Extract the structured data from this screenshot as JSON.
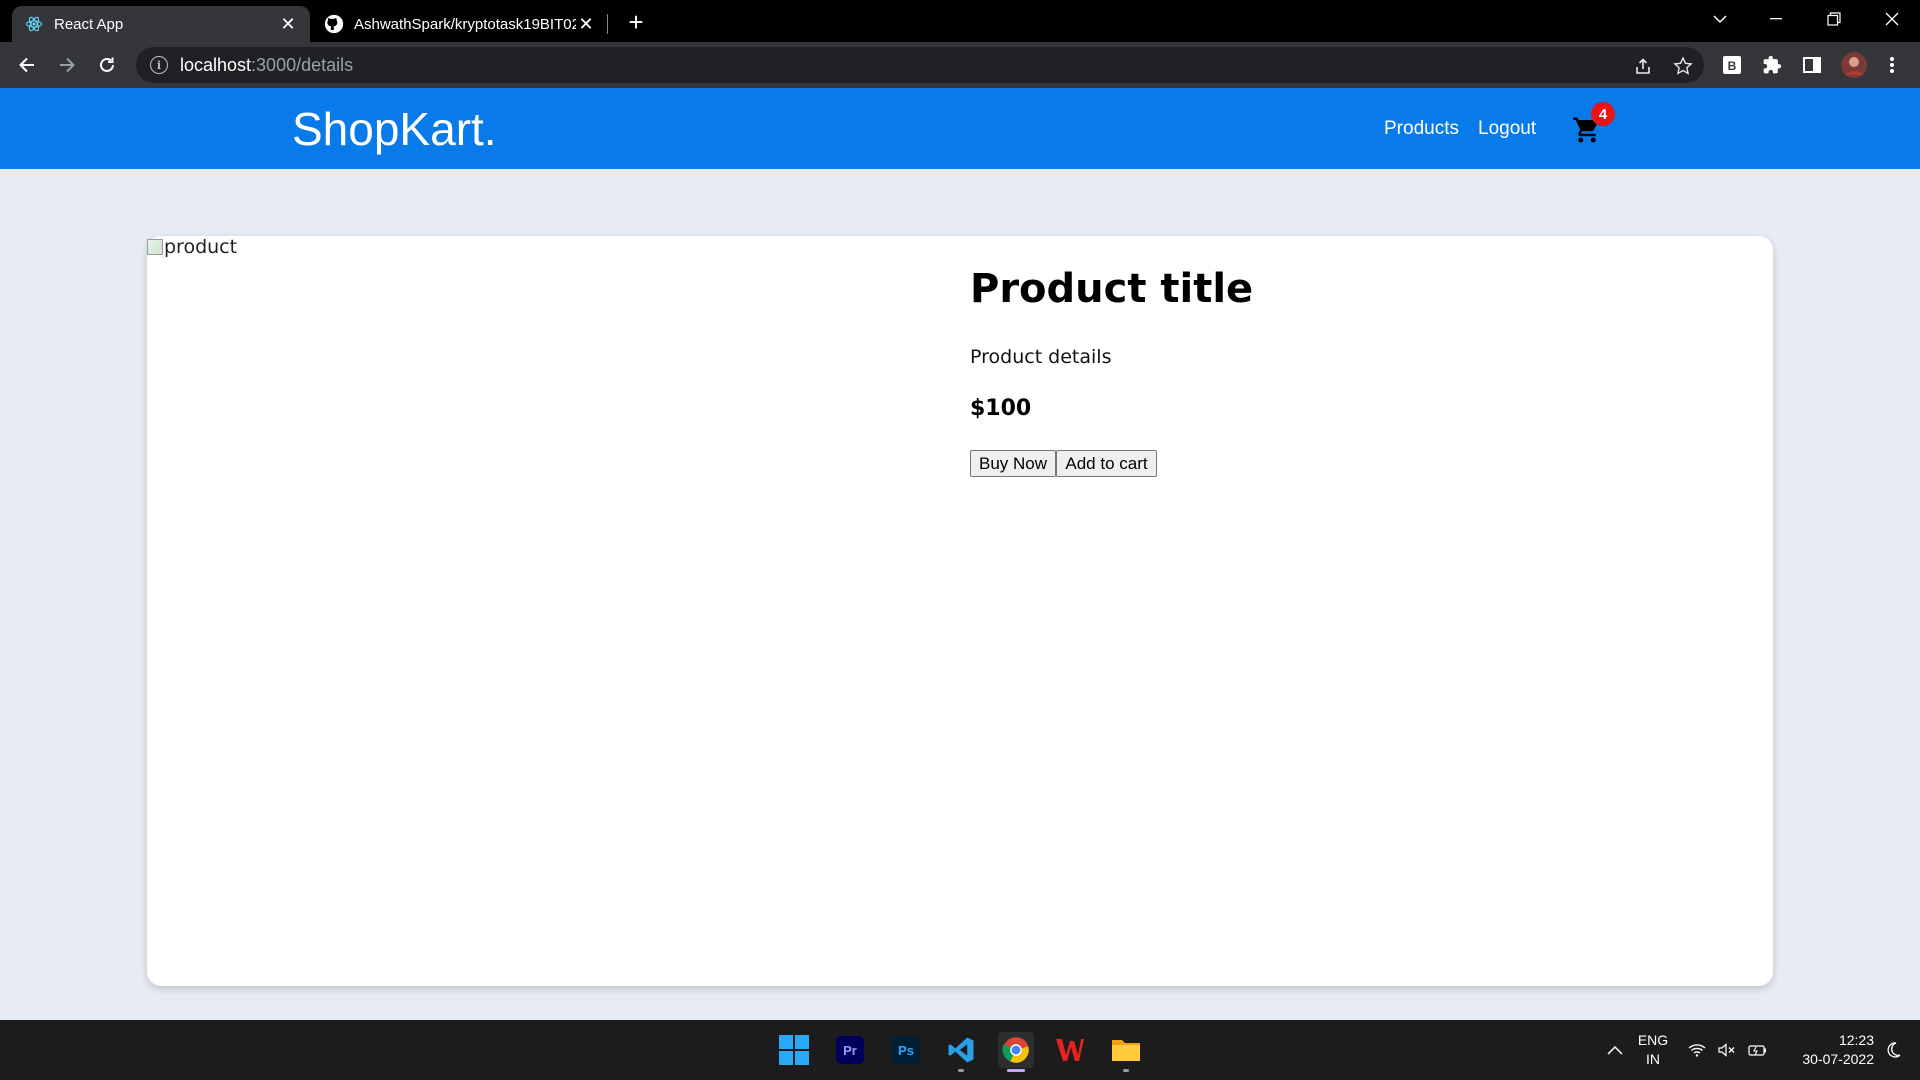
{
  "browser": {
    "tabs": [
      {
        "title": "React App",
        "icon": "react-icon",
        "active": true
      },
      {
        "title": "AshwathSpark/kryptotask19BIT02",
        "icon": "github-icon",
        "active": false
      }
    ],
    "url_host": "localhost",
    "url_path": ":3000/details"
  },
  "app": {
    "brand": "ShopKart.",
    "nav": {
      "products": "Products",
      "logout": "Logout"
    },
    "cart_count": "4",
    "header_color": "#087ae9"
  },
  "product": {
    "image_alt": "product",
    "title": "Product title",
    "details": "Product details",
    "price": "$100",
    "buy_now": "Buy Now",
    "add_to_cart": "Add to cart"
  },
  "taskbar": {
    "apps": [
      "start-icon",
      "premiere-pro-icon",
      "photoshop-icon",
      "vscode-icon",
      "chrome-icon",
      "wps-office-icon",
      "file-explorer-icon"
    ],
    "language": "ENG",
    "region": "IN",
    "time": "12:23",
    "date": "30-07-2022"
  }
}
